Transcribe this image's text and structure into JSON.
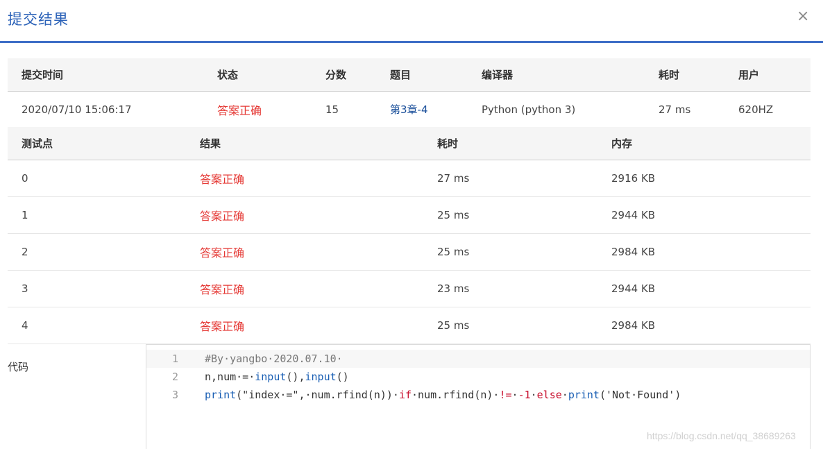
{
  "dialog": {
    "title": "提交结果",
    "close_label": "×"
  },
  "summary": {
    "headers": [
      "提交时间",
      "状态",
      "分数",
      "题目",
      "编译器",
      "耗时",
      "用户"
    ],
    "row": {
      "time": "2020/07/10 15:06:17",
      "status": "答案正确",
      "score": "15",
      "problem": "第3章-4",
      "compiler": "Python (python 3)",
      "duration": "27 ms",
      "user": "620HZ"
    }
  },
  "cases": {
    "headers": [
      "测试点",
      "结果",
      "耗时",
      "内存"
    ],
    "rows": [
      {
        "id": "0",
        "result": "答案正确",
        "time": "27 ms",
        "memory": "2916 KB"
      },
      {
        "id": "1",
        "result": "答案正确",
        "time": "25 ms",
        "memory": "2944 KB"
      },
      {
        "id": "2",
        "result": "答案正确",
        "time": "25 ms",
        "memory": "2984 KB"
      },
      {
        "id": "3",
        "result": "答案正确",
        "time": "23 ms",
        "memory": "2944 KB"
      },
      {
        "id": "4",
        "result": "答案正确",
        "time": "25 ms",
        "memory": "2984 KB"
      }
    ]
  },
  "code": {
    "label": "代码",
    "lines": [
      {
        "num": "1",
        "text": "#By·yangbo·2020.07.10·"
      },
      {
        "num": "2",
        "text": "n,num·=·input(),input()"
      },
      {
        "num": "3",
        "text": "print(\"index·=\",·num.rfind(n))·if·num.rfind(n)·!=·-1·else·print('Not·Found')"
      }
    ]
  },
  "watermark": "https://blog.csdn.net/qq_38689263"
}
